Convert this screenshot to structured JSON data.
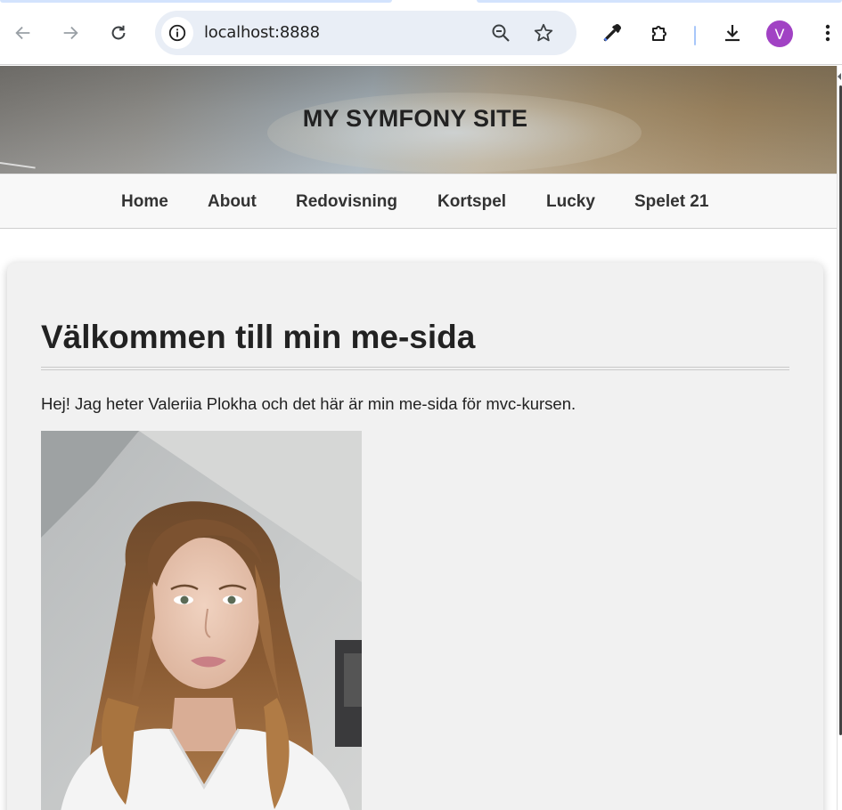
{
  "browser": {
    "url": "localhost:8888",
    "profile_initial": "V",
    "icons": {
      "back": "back-arrow-icon",
      "forward": "forward-arrow-icon",
      "reload": "reload-icon",
      "site_info": "info-icon",
      "zoom": "zoom-out-icon",
      "bookmark": "star-icon",
      "devtools": "eyedropper-icon",
      "extensions": "puzzle-icon",
      "downloads": "download-icon",
      "menu": "kebab-menu-icon"
    },
    "colors": {
      "omnibox": "#e9eef6",
      "avatar": "#a142c4"
    }
  },
  "site": {
    "title": "MY SYMFONY SITE",
    "nav": [
      "Home",
      "About",
      "Redovisning",
      "Kortspel",
      "Lucky",
      "Spelet 21"
    ]
  },
  "main": {
    "heading": "Välkommen till min me-sida",
    "intro": "Hej! Jag heter Valeriia Plokha och det här är min me-sida för mvc-kursen."
  },
  "colors": {
    "card_background": "#f1f1f1",
    "text": "#222222",
    "nav_background": "#f8f8f8"
  }
}
